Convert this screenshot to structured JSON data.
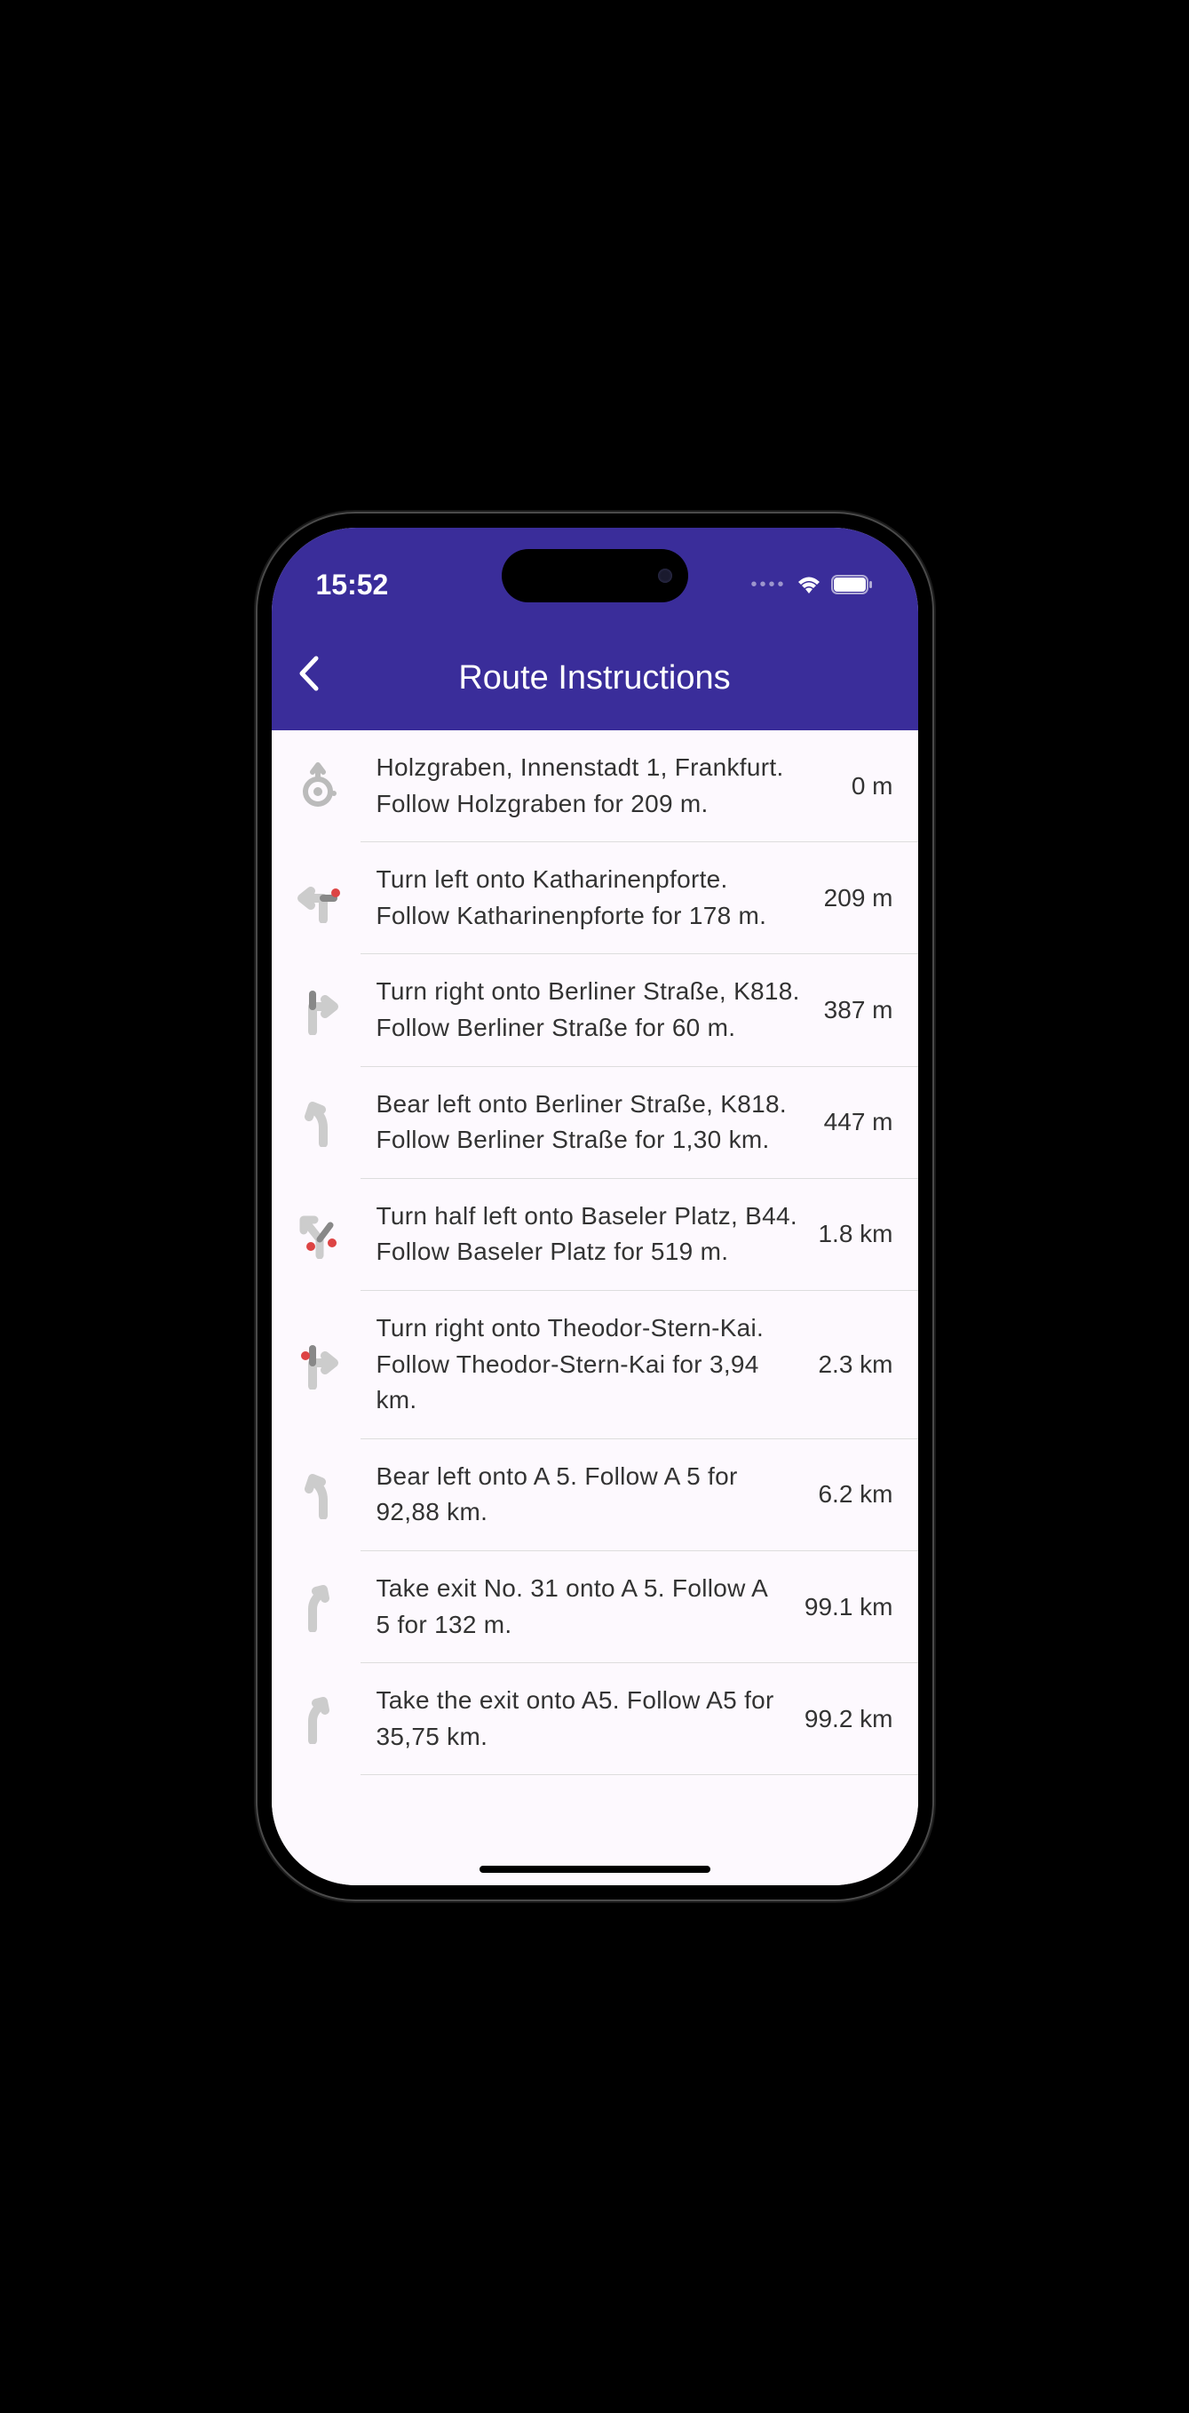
{
  "status": {
    "time": "15:52"
  },
  "nav": {
    "title": "Route Instructions"
  },
  "instructions": [
    {
      "icon": "roundabout",
      "text": "Holzgraben, Innenstadt 1, Frankfurt.\nFollow Holzgraben for 209 m.",
      "distance": "0 m"
    },
    {
      "icon": "turn-left",
      "text": "Turn left onto Katharinenpforte.\nFollow Katharinenpforte for 178 m.",
      "distance": "209 m"
    },
    {
      "icon": "turn-right",
      "text": "Turn right onto Berliner Straße, K818.\nFollow Berliner Straße for 60 m.",
      "distance": "387 m"
    },
    {
      "icon": "bear-left",
      "text": "Bear left onto Berliner Straße, K818.\nFollow Berliner Straße for 1,30 km.",
      "distance": "447 m"
    },
    {
      "icon": "half-left",
      "text": "Turn half left onto Baseler Platz, B44.\nFollow Baseler Platz for 519 m.",
      "distance": "1.8 km"
    },
    {
      "icon": "turn-right-restricted",
      "text": "Turn right onto Theodor-Stern-Kai.\nFollow Theodor-Stern-Kai for 3,94 km.",
      "distance": "2.3 km"
    },
    {
      "icon": "bear-left",
      "text": "Bear left onto A 5.\nFollow A 5 for 92,88 km.",
      "distance": "6.2 km"
    },
    {
      "icon": "exit-right",
      "text": "Take exit No. 31 onto A 5.\nFollow A 5 for 132 m.",
      "distance": "99.1 km"
    },
    {
      "icon": "exit-right",
      "text": "Take the exit onto A5.\nFollow A5 for 35,75 km.",
      "distance": "99.2 km"
    }
  ]
}
